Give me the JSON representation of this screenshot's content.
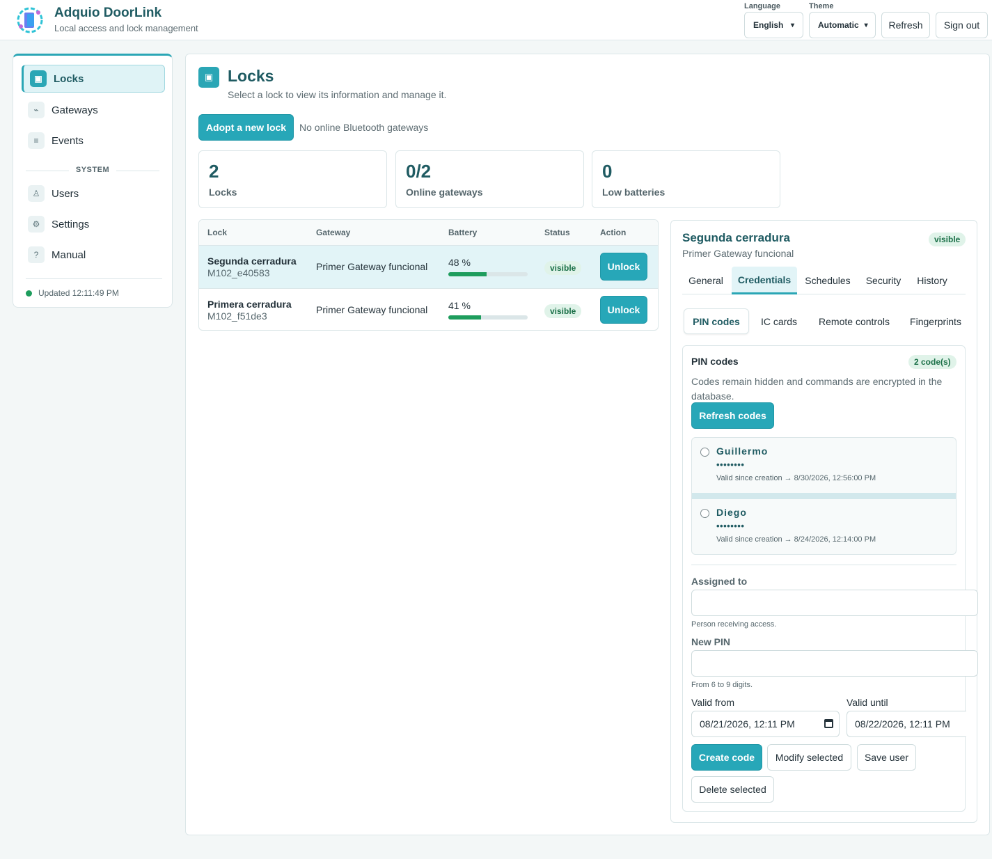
{
  "header": {
    "app_title": "Adquio DoorLink",
    "app_subtitle": "Local access and lock management",
    "language_label": "Language",
    "language_value": "English",
    "theme_label": "Theme",
    "theme_value": "Automatic",
    "refresh_label": "Refresh",
    "signout_label": "Sign out"
  },
  "sidebar": {
    "items": [
      {
        "label": "Locks",
        "icon": "▣"
      },
      {
        "label": "Gateways",
        "icon": "⌁"
      },
      {
        "label": "Events",
        "icon": "≡"
      },
      {
        "label": "Users",
        "icon": "♙"
      },
      {
        "label": "Settings",
        "icon": "⚙"
      },
      {
        "label": "Manual",
        "icon": "?"
      }
    ],
    "section_label": "SYSTEM",
    "updated_text": "Updated 12:11:49 PM"
  },
  "main": {
    "title": "Locks",
    "subtitle": "Select a lock to view its information and manage it.",
    "adopt_label": "Adopt a new lock",
    "no_gateways_text": "No online Bluetooth gateways",
    "stats": [
      {
        "value": "2",
        "label": "Locks"
      },
      {
        "value": "0/2",
        "label": "Online gateways"
      },
      {
        "value": "0",
        "label": "Low batteries"
      }
    ]
  },
  "table": {
    "headers": [
      "Lock",
      "Gateway",
      "Battery",
      "Status",
      "Action"
    ],
    "rows": [
      {
        "name": "Segunda cerradura",
        "id": "M102_e40583",
        "gateway": "Primer Gateway funcional",
        "battery_text": "48 %",
        "battery_pct": 48,
        "status": "visible",
        "action": "Unlock"
      },
      {
        "name": "Primera cerradura",
        "id": "M102_f51de3",
        "gateway": "Primer Gateway funcional",
        "battery_text": "41 %",
        "battery_pct": 41,
        "status": "visible",
        "action": "Unlock"
      }
    ]
  },
  "detail": {
    "title": "Segunda cerradura",
    "subtitle": "Primer Gateway funcional",
    "badge": "visible",
    "tabs": [
      "General",
      "Credentials",
      "Schedules",
      "Security",
      "History"
    ],
    "subtabs": [
      "PIN codes",
      "IC cards",
      "Remote controls",
      "Fingerprints"
    ],
    "card": {
      "title": "PIN codes",
      "count_badge": "2 code(s)",
      "description": "Codes remain hidden and commands are encrypted in the database.",
      "refresh_label": "Refresh codes",
      "codes": [
        {
          "name": "Guillermo",
          "mask": "••••••••",
          "validity": "Valid since creation → 8/30/2026, 12:56:00 PM"
        },
        {
          "name": "Diego",
          "mask": "••••••••",
          "validity": "Valid since creation → 8/24/2026, 12:14:00 PM"
        }
      ],
      "assigned_label": "Assigned to",
      "assigned_hint": "Person receiving access.",
      "pin_label": "New PIN",
      "pin_hint": "From 6 to 9 digits.",
      "valid_from_label": "Valid from",
      "valid_from_value": "08/21/2026, 12:11 PM",
      "valid_until_label": "Valid until",
      "valid_until_value": "08/22/2026, 12:11 PM",
      "create_label": "Create code",
      "modify_label": "Modify selected",
      "save_label": "Save user",
      "delete_label": "Delete selected"
    }
  }
}
